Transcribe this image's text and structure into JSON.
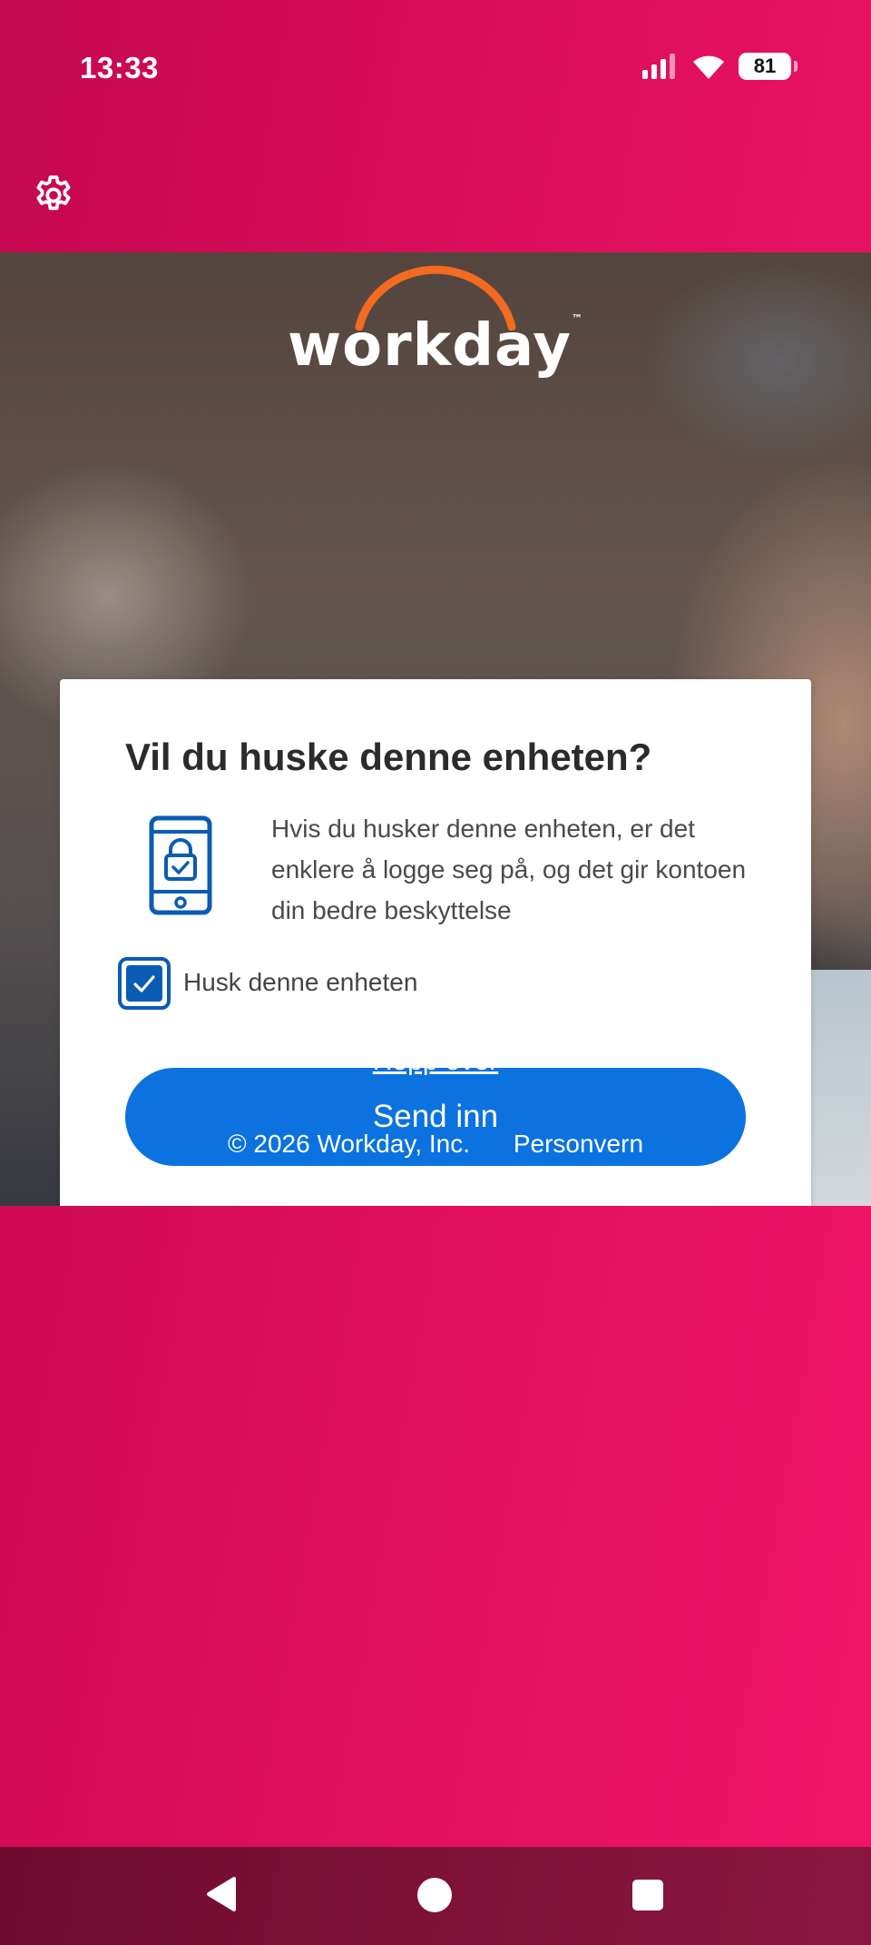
{
  "status_bar": {
    "time": "13:33",
    "battery": "81",
    "icons": [
      "signal-icon",
      "wifi-icon",
      "battery-icon"
    ]
  },
  "header": {
    "settings_icon": "gear-icon"
  },
  "logo": {
    "text": "workday",
    "trademark": "™",
    "arc_color": "#f26b21"
  },
  "card": {
    "title": "Vil du huske denne enheten?",
    "description": "Hvis du husker denne enheten, er det enklere å logge seg på, og det gir kontoen din bedre beskyttelse",
    "icon": "phone-lock-icon",
    "checkbox_label": "Husk denne enheten",
    "checkbox_checked": true,
    "submit_label": "Send inn"
  },
  "skip_label": "Hopp over",
  "footer": {
    "copyright": "© 2026 Workday, Inc.",
    "privacy": "Personvern"
  },
  "colors": {
    "background_pink": "#de0f5c",
    "primary_blue": "#0b72e0",
    "icon_blue": "#0b5cb3"
  },
  "nav_bar": {
    "icons": [
      "back-icon",
      "home-icon",
      "recents-icon"
    ]
  }
}
